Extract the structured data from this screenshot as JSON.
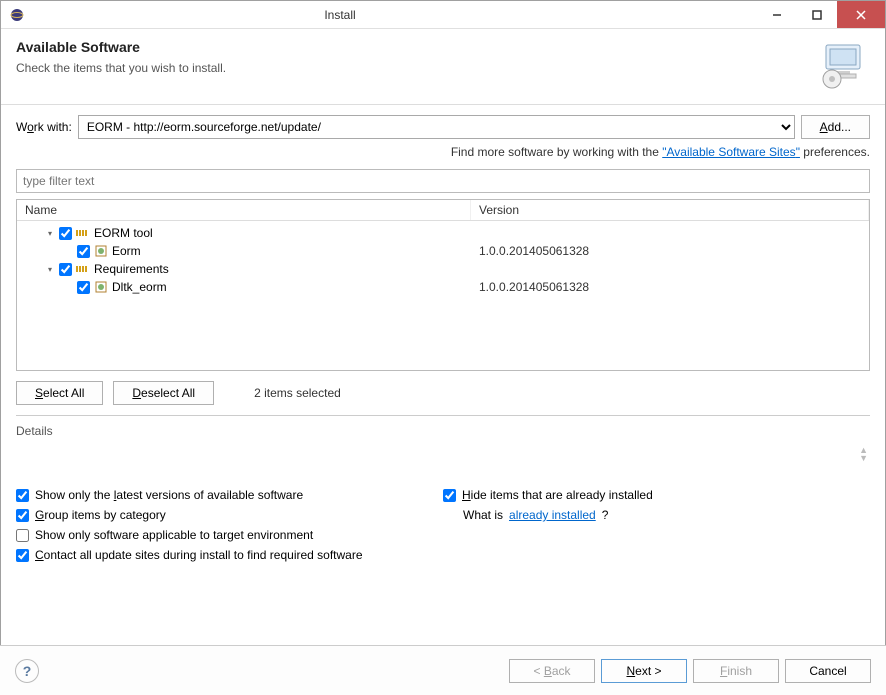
{
  "window": {
    "title": "Install"
  },
  "header": {
    "title": "Available Software",
    "subtitle": "Check the items that you wish to install."
  },
  "workwith": {
    "label_pre": "W",
    "label_u": "o",
    "label_post": "rk with:",
    "value": "EORM - http://eorm.sourceforge.net/update/",
    "add_label": "Add..."
  },
  "findmore": {
    "pre": "Find more software by working with the ",
    "link": "Available Software Sites",
    "post": " preferences."
  },
  "filter": {
    "placeholder": "type filter text"
  },
  "columns": {
    "name": "Name",
    "version": "Version"
  },
  "tree": [
    {
      "type": "category",
      "label": "EORM tool",
      "checked": true,
      "expanded": true,
      "children": [
        {
          "type": "feature",
          "label": "Eorm",
          "version": "1.0.0.201405061328",
          "checked": true
        }
      ]
    },
    {
      "type": "category",
      "label": "Requirements",
      "checked": true,
      "expanded": true,
      "children": [
        {
          "type": "feature",
          "label": "Dltk_eorm",
          "version": "1.0.0.201405061328",
          "checked": true
        }
      ]
    }
  ],
  "selection": {
    "select_all": "Select All",
    "deselect_all": "Deselect All",
    "status": "2 items selected"
  },
  "details": {
    "label": "Details"
  },
  "options": {
    "latest": {
      "label": "Show only the latest versions of available software",
      "checked": true
    },
    "group": {
      "label": "Group items by category",
      "checked": true
    },
    "applicable": {
      "label": "Show only software applicable to target environment",
      "checked": false
    },
    "contact": {
      "label": "Contact all update sites during install to find required software",
      "checked": true
    },
    "hide": {
      "label": "Hide items that are already installed",
      "checked": true
    },
    "whatis_pre": "What is ",
    "whatis_link": "already installed",
    "whatis_post": "?"
  },
  "buttons": {
    "back": "< Back",
    "next": "Next >",
    "finish": "Finish",
    "cancel": "Cancel"
  }
}
